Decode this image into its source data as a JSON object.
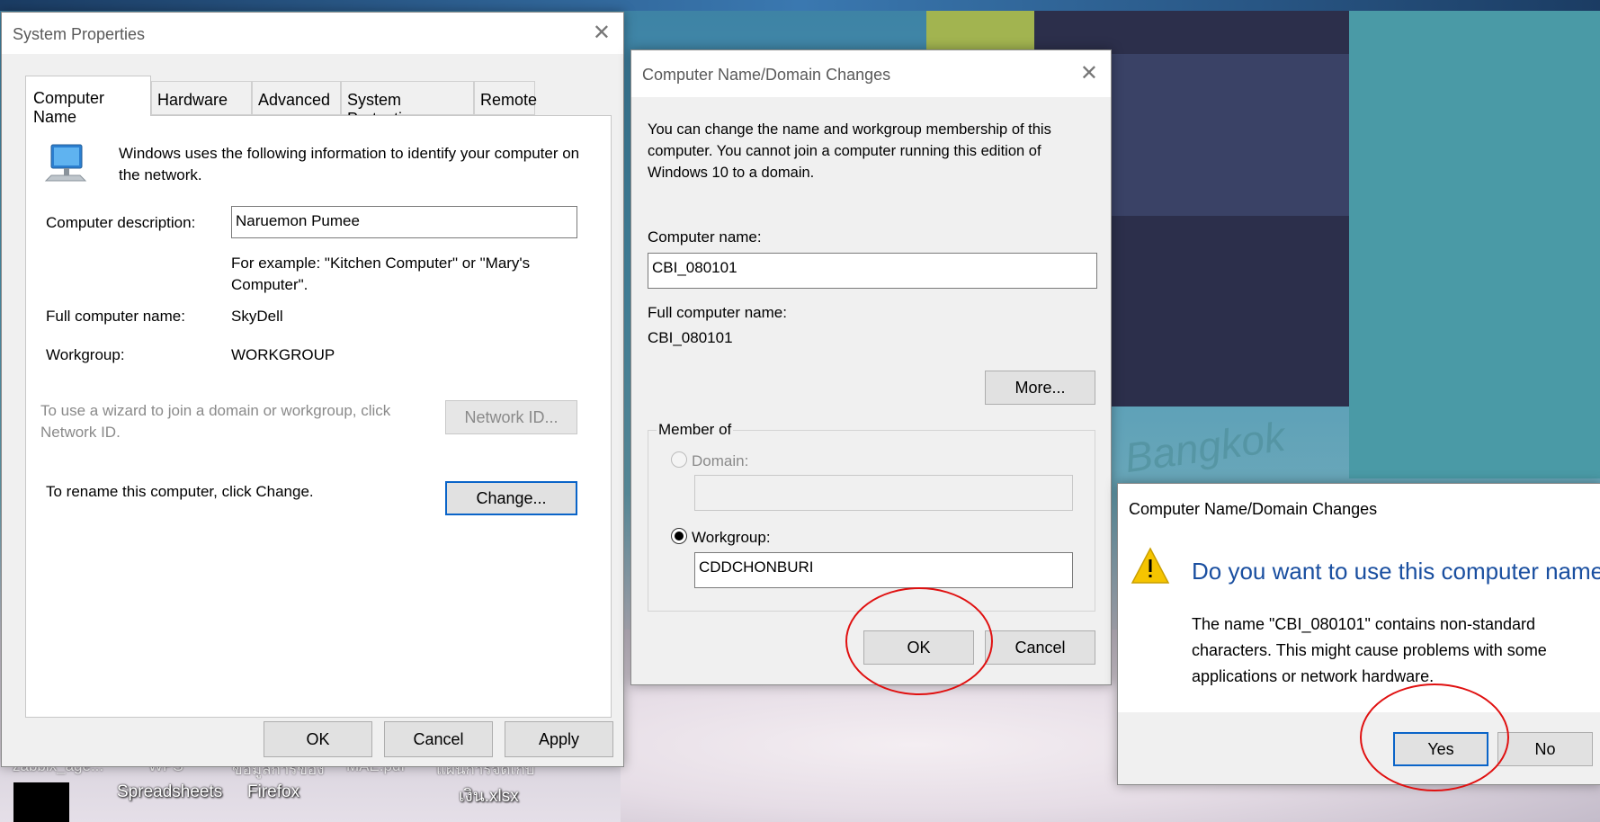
{
  "desktop": {
    "wallpaper_text": "Bangkok",
    "icons_row1": [
      "zabbix_age...",
      "WPS",
      "ข้อมูลการของ",
      "MAE.pdf",
      "แผนการจัดเก็บ"
    ],
    "icons_row2": [
      "Spreadsheets",
      "Firefox",
      "เงิน.xlsx"
    ]
  },
  "system_properties": {
    "title": "System Properties",
    "tabs": [
      "Computer Name",
      "Hardware",
      "Advanced",
      "System Protection",
      "Remote"
    ],
    "active_tab": "Computer Name",
    "intro": "Windows uses the following information to identify your computer on the network.",
    "description_label": "Computer description:",
    "description_value": "Naruemon Pumee",
    "example": "For example: \"Kitchen Computer\" or \"Mary's Computer\".",
    "full_name_label": "Full computer name:",
    "full_name_value": "SkyDell",
    "workgroup_label": "Workgroup:",
    "workgroup_value": "WORKGROUP",
    "wizard_text": "To use a wizard to join a domain or workgroup, click Network ID.",
    "network_id_button": "Network ID...",
    "rename_text": "To rename this computer, click Change.",
    "change_button": "Change...",
    "ok_button": "OK",
    "cancel_button": "Cancel",
    "apply_button": "Apply"
  },
  "domain_changes": {
    "title": "Computer Name/Domain Changes",
    "intro": "You can change the name and workgroup membership of this computer. You cannot join a computer running this edition of Windows 10 to a domain.",
    "computer_name_label": "Computer name:",
    "computer_name_value": "CBI_080101",
    "full_name_label": "Full computer name:",
    "full_name_value": "CBI_080101",
    "more_button": "More...",
    "member_of_label": "Member of",
    "domain_label": "Domain:",
    "domain_value": "",
    "workgroup_label": "Workgroup:",
    "workgroup_value": "CDDCHONBURI",
    "ok_button": "OK",
    "cancel_button": "Cancel"
  },
  "confirm": {
    "title": "Computer Name/Domain Changes",
    "heading": "Do you want to use this computer name?",
    "message": "The name \"CBI_080101\" contains non-standard characters. This might cause problems with some applications or network hardware.",
    "yes_button": "Yes",
    "no_button": "No"
  },
  "colors": {
    "heading_blue": "#1a4fa0",
    "highlight_red": "#e01010",
    "focus_blue": "#0a64c8",
    "warning_yellow": "#f5c400"
  }
}
